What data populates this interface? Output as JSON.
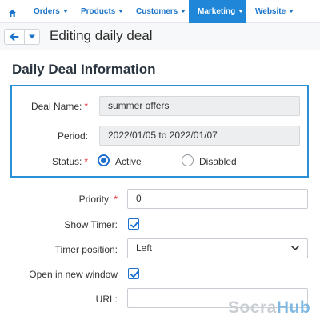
{
  "nav": {
    "items": [
      {
        "label": "Orders"
      },
      {
        "label": "Products"
      },
      {
        "label": "Customers"
      },
      {
        "label": "Marketing"
      },
      {
        "label": "Website"
      }
    ],
    "active": "Marketing"
  },
  "header": {
    "title": "Editing daily deal"
  },
  "section": {
    "title": "Daily Deal Information"
  },
  "form": {
    "deal_name": {
      "label": "Deal Name:",
      "value": "summer offers",
      "required": true
    },
    "period": {
      "label": "Period:",
      "value": "2022/01/05 to 2022/01/07"
    },
    "status": {
      "label": "Status:",
      "required": true,
      "options": [
        {
          "label": "Active",
          "checked": true
        },
        {
          "label": "Disabled",
          "checked": false
        }
      ]
    },
    "priority": {
      "label": "Priority:",
      "value": "0",
      "required": true
    },
    "show_timer": {
      "label": "Show Timer:",
      "checked": true
    },
    "timer_position": {
      "label": "Timer position:",
      "value": "Left"
    },
    "open_new_window": {
      "label": "Open in new window",
      "checked": true
    },
    "url": {
      "label": "URL:",
      "value": ""
    }
  },
  "watermark": {
    "part1": "Socra",
    "part2": "Hub"
  },
  "colors": {
    "accent": "#1f86d8",
    "required": "#e0242b",
    "highlight": "#2a8fd6"
  }
}
